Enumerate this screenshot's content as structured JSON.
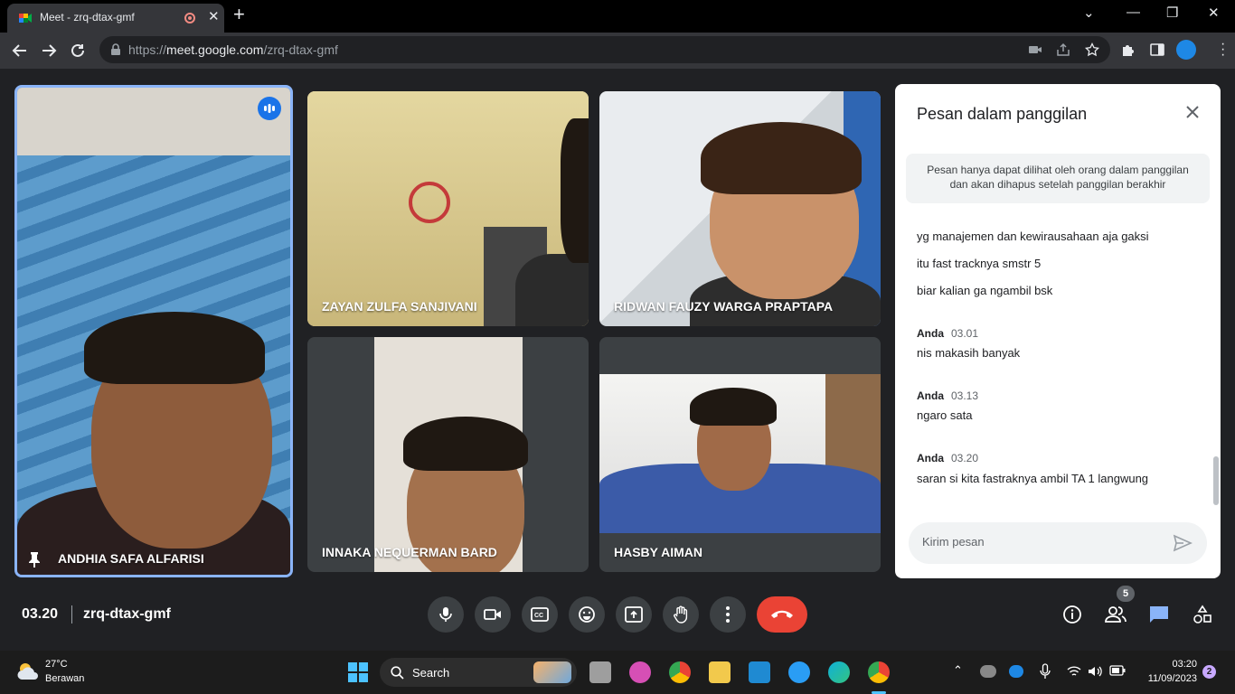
{
  "browser": {
    "tab_title": "Meet - zrq-dtax-gmf",
    "url_prefix": "https://",
    "url_host": "meet.google.com",
    "url_path": "/zrq-dtax-gmf"
  },
  "participants": [
    {
      "name": "ANDHIA SAFA ALFARISI",
      "pinned": true,
      "speaking": true
    },
    {
      "name": "ZAYAN ZULFA SANJIVANI"
    },
    {
      "name": "RIDWAN FAUZY WARGA PRAPTAPA"
    },
    {
      "name": "INNAKA NEQUERMAN BARD"
    },
    {
      "name": "HASBY AIMAN"
    }
  ],
  "chat": {
    "title": "Pesan dalam panggilan",
    "notice_line1": "Pesan hanya dapat dilihat oleh orang dalam panggilan",
    "notice_line2": "dan akan dihapus setelah panggilan berakhir",
    "messages_continued": [
      "yg manajemen dan kewirausahaan aja gaksi",
      "itu fast tracknya smstr 5",
      "biar kalian ga ngambil bsk"
    ],
    "groups": [
      {
        "sender": "Anda",
        "time": "03.01",
        "text": "nis makasih banyak"
      },
      {
        "sender": "Anda",
        "time": "03.13",
        "text": "ngaro sata"
      },
      {
        "sender": "Anda",
        "time": "03.20",
        "text": "saran si kita fastraknya ambil TA 1 langwung"
      }
    ],
    "input_placeholder": "Kirim pesan"
  },
  "meeting": {
    "time": "03.20",
    "code": "zrq-dtax-gmf",
    "participant_count": "5"
  },
  "taskbar": {
    "weather_temp": "27°C",
    "weather_desc": "Berawan",
    "search_label": "Search",
    "time": "03:20",
    "date": "11/09/2023",
    "notification_count": "2"
  },
  "colors": {
    "accent_blue": "#8ab4f8",
    "leave_red": "#ea4335",
    "meet_bg": "#202124"
  }
}
